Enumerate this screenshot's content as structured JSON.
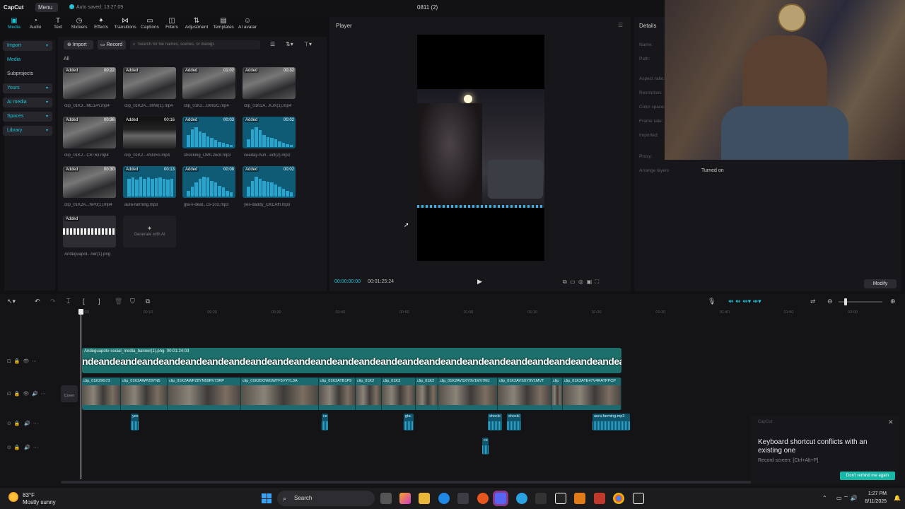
{
  "app": {
    "logo": "CapCut",
    "menu": "Menu",
    "autosave": "Auto saved: 13:27:09",
    "project_title": "0811 (2)"
  },
  "toolbar": {
    "items": [
      "Media",
      "Audio",
      "Text",
      "Stickers",
      "Effects",
      "Transitions",
      "Captions",
      "Filters",
      "Adjustment",
      "Templates",
      "AI avatar"
    ]
  },
  "leftnav": {
    "items": [
      {
        "label": "Import",
        "chev": "▾"
      },
      {
        "label": "Media",
        "chev": ""
      },
      {
        "label": "Subprojects",
        "chev": ""
      },
      {
        "label": "Yours",
        "chev": "▾"
      },
      {
        "label": "AI media",
        "chev": "▾"
      },
      {
        "label": "Spaces",
        "chev": "▾"
      },
      {
        "label": "Library",
        "chev": "▾"
      }
    ]
  },
  "media": {
    "import_label": "Import",
    "record_label": "Record",
    "search_placeholder": "Search for file names, scenes, or dialogs",
    "tab_all": "All",
    "items": [
      {
        "badge": "Added",
        "dur": "00:22",
        "name": "clip_01K3...ME1AY.mp4",
        "kind": "video"
      },
      {
        "badge": "Added",
        "dur": "",
        "name": "clip_01K2A...90W(1).mp4",
        "kind": "video"
      },
      {
        "badge": "Added",
        "dur": "01:02",
        "name": "clip_01K2...G692C.mp4",
        "kind": "video"
      },
      {
        "badge": "Added",
        "dur": "00:32",
        "name": "clip_01K2A...KJX(1).mp4",
        "kind": "video"
      },
      {
        "badge": "Added",
        "dur": "00:36",
        "name": "clip_01K2...C8T63.mp4",
        "kind": "video"
      },
      {
        "badge": "Added",
        "dur": "00:16",
        "name": "clip_01K2...4SG5S.mp4",
        "kind": "video"
      },
      {
        "badge": "Added",
        "dur": "00:03",
        "name": "shocking_OWL2w3l.mp3",
        "kind": "audio"
      },
      {
        "badge": "Added",
        "dur": "00:02",
        "name": "ceeday-huh...ect(2).mp3",
        "kind": "audio"
      },
      {
        "badge": "Added",
        "dur": "00:30",
        "name": "clip_01K2A...NP0(1).mp4",
        "kind": "video"
      },
      {
        "badge": "Added",
        "dur": "00:13",
        "name": "aura-farming.mp3",
        "kind": "audio"
      },
      {
        "badge": "Added",
        "dur": "00:08",
        "name": "gta-v-deat...cs-102.mp3",
        "kind": "audio"
      },
      {
        "badge": "Added",
        "dur": "00:02",
        "name": "yes-daddy_CKEAffl.mp3",
        "kind": "audio"
      },
      {
        "badge": "Added",
        "dur": "",
        "name": "Andeguapot...ner(1).png",
        "kind": "image"
      }
    ],
    "generate_label": "Generate with AI"
  },
  "player": {
    "title": "Player",
    "time_current": "00:00:00:00",
    "time_total": "00:01:25:24"
  },
  "details": {
    "title": "Details",
    "labels": [
      "Name:",
      "Path:",
      "Aspect ratio:",
      "Resolution:",
      "Color space:",
      "Frame rate:",
      "Imported:",
      "Proxy:",
      "Arrange layers"
    ],
    "arrange_value": "Turned on",
    "modify_label": "Modify"
  },
  "timeline": {
    "ruler": [
      "00:00",
      "00:10",
      "00:20",
      "00:30",
      "00:40",
      "00:50",
      "01:00",
      "01:10",
      "01:20",
      "01:30",
      "01:40",
      "01:50",
      "02:00"
    ],
    "text_clip": {
      "name": "Andeguapotv-social_media_banner(1).png",
      "dur": "00:01:24:03",
      "pattern": "ndeandeandeandeandeandeandeandeandeandeandeandeandeandeandeandeandeandeandeandeandeandeandeandeandeandeandeandeande"
    },
    "cover_label": "Cover",
    "video_clips": [
      "clip_01K29G73",
      "clip_01K2AWPZ8YN5",
      "clip_01K2AWPZ8YN59RV73RP",
      "clip_01K2DOWGWTF5VYYL3A",
      "clip_01K2ATB1P9",
      "clip_01K2",
      "clip_01K3",
      "clip_01K2",
      "clip_01K2AVSXY9V1MV7MJ",
      "clip_01K2AVSXY9V1MVT",
      "clip",
      "clip_01K2ATE47V4RATPPCP"
    ],
    "audio_clips": [
      "yes",
      "ce",
      "gta-",
      "shocki",
      "shocki",
      "aura-farming.mp3",
      "ce"
    ]
  },
  "toast": {
    "app": "CapCut",
    "title": "Keyboard shortcut conflicts with an existing one",
    "sub": "Record screen: [Ctrl+Alt+P]",
    "button": "Don't remind me again"
  },
  "taskbar": {
    "temp": "83°F",
    "weather": "Mostly sunny",
    "search": "Search",
    "time": "1:27 PM",
    "date": "8/11/2025"
  }
}
